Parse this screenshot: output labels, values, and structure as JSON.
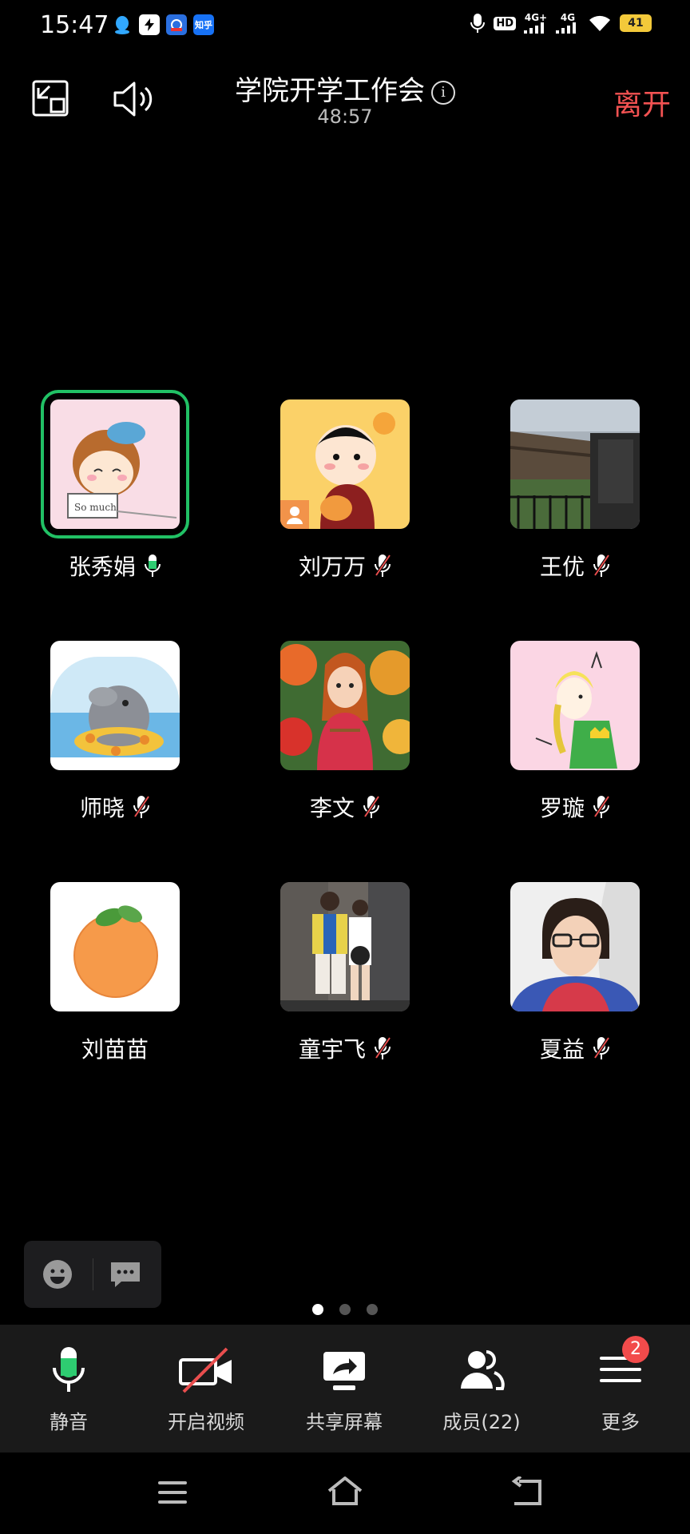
{
  "status_bar": {
    "time": "15:47",
    "network": "4G+",
    "network2": "4G",
    "battery": "41",
    "hd_label": "HD",
    "app_zhihu": "知乎"
  },
  "header": {
    "title": "学院开学工作会",
    "timer": "48:57",
    "leave_label": "离开"
  },
  "participants": [
    {
      "name": "张秀娟",
      "mic": "on",
      "speaking": true
    },
    {
      "name": "刘万万",
      "mic": "muted"
    },
    {
      "name": "王优",
      "mic": "muted"
    },
    {
      "name": "师晓",
      "mic": "muted"
    },
    {
      "name": "李文",
      "mic": "muted"
    },
    {
      "name": "罗璇",
      "mic": "muted"
    },
    {
      "name": "刘苗苗",
      "mic": "none"
    },
    {
      "name": "童宇飞",
      "mic": "muted"
    },
    {
      "name": "夏益",
      "mic": "muted"
    }
  ],
  "pagination": {
    "pages": 3,
    "current": 1
  },
  "avatar_caption": "So much",
  "toolbar": {
    "mute_label": "静音",
    "video_label": "开启视频",
    "share_label": "共享屏幕",
    "members_label": "成员(22)",
    "more_label": "更多",
    "more_badge": "2"
  },
  "colors": {
    "accent_green": "#21c165",
    "leave_red": "#f25252",
    "badge_red": "#f24b4b"
  }
}
